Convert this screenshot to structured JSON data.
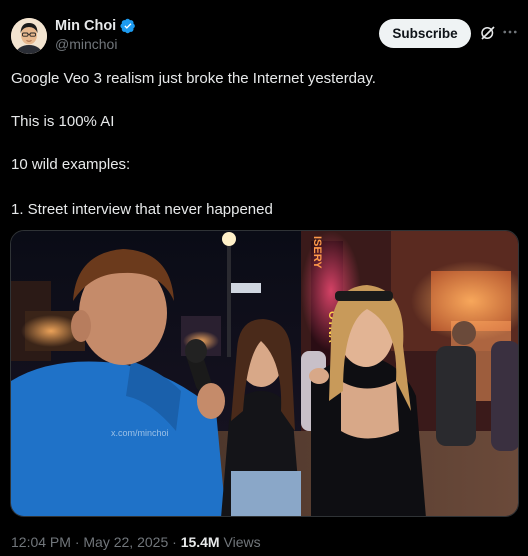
{
  "author": {
    "display_name": "Min Choi",
    "handle": "@minchoi",
    "verified": true,
    "avatar_icon": "avatar-portrait-icon"
  },
  "actions": {
    "subscribe_label": "Subscribe",
    "grok_icon": "grok-icon",
    "more_icon": "more-icon"
  },
  "tweet": {
    "lines": [
      "Google Veo 3 realism just broke the Internet yesterday.",
      "This is 100% AI",
      "10 wild examples:",
      "1. Street interview that never happened"
    ]
  },
  "media": {
    "watermark": "x.com/minchoi",
    "sign_text": "OYNA",
    "sign_text_2": "ISERY"
  },
  "meta": {
    "time": "12:04 PM",
    "separator": "·",
    "date": "May 22, 2025",
    "views_count": "15.4M",
    "views_label": "Views"
  },
  "colors": {
    "background": "#000000",
    "text": "#e7e9ea",
    "muted": "#71767b",
    "verified_blue": "#1d9bf0",
    "subscribe_bg": "#eff3f4"
  }
}
